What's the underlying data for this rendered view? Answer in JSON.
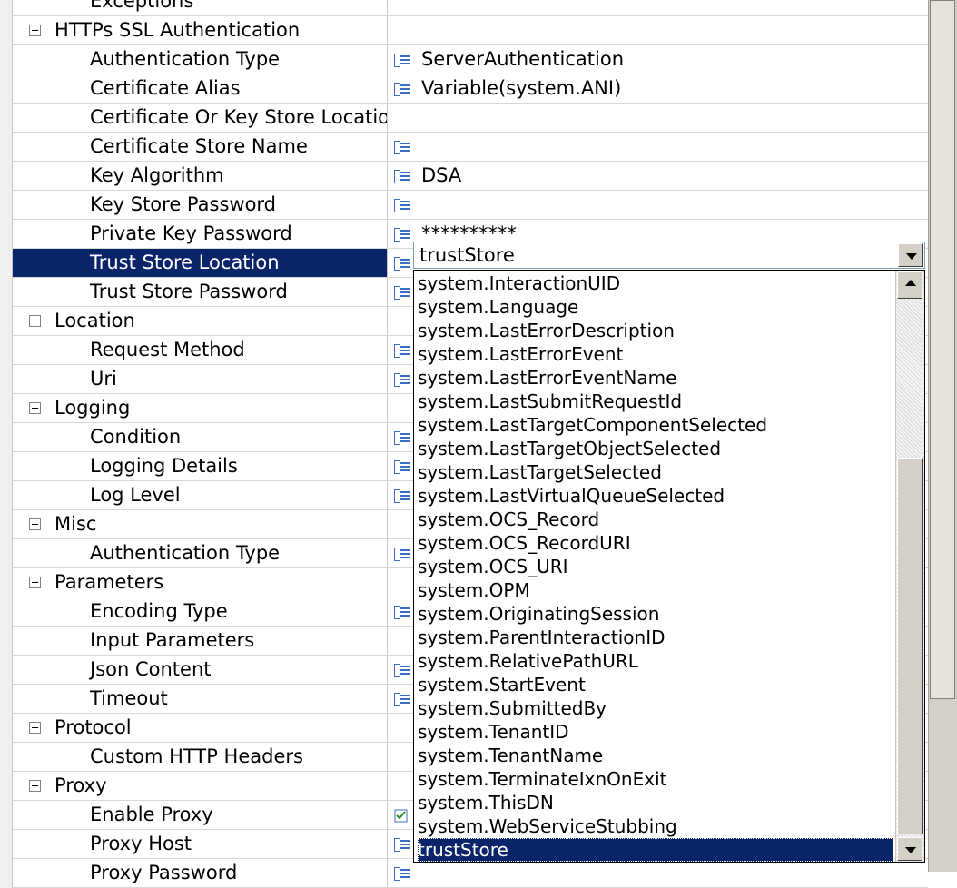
{
  "property_grid": {
    "partial_top_label": "Exceptions",
    "sections": [
      {
        "category": "HTTPs SSL Authentication",
        "expanded": true,
        "properties": [
          {
            "name": "Authentication Type",
            "icon": "variable-icon",
            "value": "ServerAuthentication"
          },
          {
            "name": "Certificate Alias",
            "icon": "variable-icon",
            "value": "Variable(system.ANI)"
          },
          {
            "name": "Certificate Or Key Store Location",
            "icon": "",
            "value": ""
          },
          {
            "name": "Certificate Store Name",
            "icon": "variable-icon",
            "value": ""
          },
          {
            "name": "Key Algorithm",
            "icon": "variable-icon",
            "value": "DSA"
          },
          {
            "name": "Key Store Password",
            "icon": "variable-icon",
            "value": ""
          },
          {
            "name": "Private Key Password",
            "icon": "variable-icon",
            "value": "**********"
          },
          {
            "name": "Trust Store Location",
            "icon": "variable-icon",
            "value": "",
            "selected": true
          },
          {
            "name": "Trust Store Password",
            "icon": "variable-icon",
            "value": ""
          }
        ]
      },
      {
        "category": "Location",
        "expanded": true,
        "properties": [
          {
            "name": "Request Method",
            "icon": "variable-icon",
            "value": ""
          },
          {
            "name": "Uri",
            "icon": "variable-icon",
            "value": ""
          }
        ]
      },
      {
        "category": "Logging",
        "expanded": true,
        "properties": [
          {
            "name": "Condition",
            "icon": "variable-icon",
            "value": ""
          },
          {
            "name": "Logging Details",
            "icon": "variable-icon",
            "value": ""
          },
          {
            "name": "Log Level",
            "icon": "variable-icon",
            "value": ""
          }
        ]
      },
      {
        "category": "Misc",
        "expanded": true,
        "properties": [
          {
            "name": "Authentication Type",
            "icon": "variable-icon",
            "value": ""
          }
        ]
      },
      {
        "category": "Parameters",
        "expanded": true,
        "properties": [
          {
            "name": "Encoding Type",
            "icon": "variable-icon",
            "value": ""
          },
          {
            "name": "Input Parameters",
            "icon": "",
            "value": ""
          },
          {
            "name": "Json Content",
            "icon": "variable-icon",
            "value": ""
          },
          {
            "name": "Timeout",
            "icon": "variable-icon",
            "value": ""
          }
        ]
      },
      {
        "category": "Protocol",
        "expanded": true,
        "properties": [
          {
            "name": "Custom HTTP Headers",
            "icon": "",
            "value": ""
          }
        ]
      },
      {
        "category": "Proxy",
        "expanded": true,
        "properties": [
          {
            "name": "Enable Proxy",
            "icon": "checkbox-icon",
            "value": ""
          },
          {
            "name": "Proxy Host",
            "icon": "variable-icon",
            "value": ""
          },
          {
            "name": "Proxy Password",
            "icon": "variable-icon",
            "value": ""
          }
        ]
      }
    ]
  },
  "dropdown": {
    "selected_value": "trustStore",
    "items": [
      "system.InteractionUID",
      "system.Language",
      "system.LastErrorDescription",
      "system.LastErrorEvent",
      "system.LastErrorEventName",
      "system.LastSubmitRequestId",
      "system.LastTargetComponentSelected",
      "system.LastTargetObjectSelected",
      "system.LastTargetSelected",
      "system.LastVirtualQueueSelected",
      "system.OCS_Record",
      "system.OCS_RecordURI",
      "system.OCS_URI",
      "system.OPM",
      "system.OriginatingSession",
      "system.ParentInteractionID",
      "system.RelativePathURL",
      "system.StartEvent",
      "system.SubmittedBy",
      "system.TenantID",
      "system.TenantName",
      "system.TerminateIxnOnExit",
      "system.ThisDN",
      "system.WebServiceStubbing",
      "trustStore"
    ],
    "highlighted_item": "trustStore"
  },
  "colors": {
    "selection": "#0a246a",
    "grid_line": "#d8d8d8",
    "icon_blue": "#3a6fc4"
  }
}
